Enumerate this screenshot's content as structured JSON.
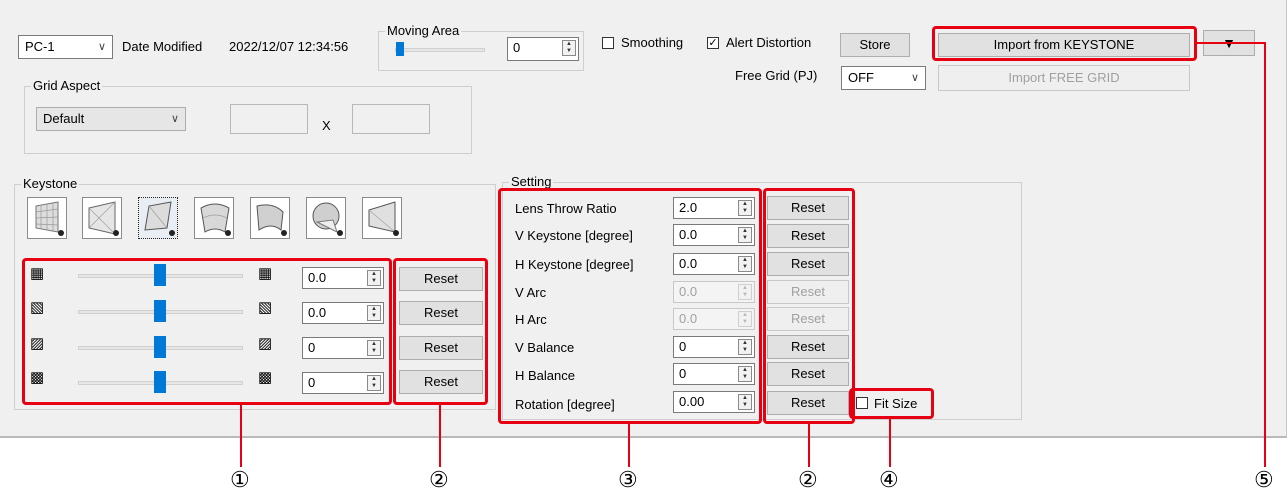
{
  "header": {
    "pc_select": "PC-1",
    "date_label": "Date Modified",
    "date_value": "2022/12/07 12:34:56",
    "moving_area_label": "Moving Area",
    "moving_area_value": "0",
    "smoothing_label": "Smoothing",
    "smoothing_checked": false,
    "alert_label": "Alert Distortion",
    "alert_checked": true,
    "store_label": "Store",
    "import_keystone_label": "Import from KEYSTONE",
    "free_grid_label": "Free Grid (PJ)",
    "free_grid_value": "OFF",
    "import_free_grid_label": "Import FREE GRID"
  },
  "grid_aspect": {
    "label": "Grid Aspect",
    "value": "Default",
    "separator": "X"
  },
  "keystone": {
    "label": "Keystone",
    "tools": [
      "keystone-grid-icon",
      "keystone-flat-icon",
      "keystone-corner-icon",
      "keystone-cylinder-icon",
      "keystone-cylinder-side-icon",
      "keystone-sphere-icon",
      "keystone-perspective-icon"
    ],
    "rows": [
      {
        "value": "0.0",
        "reset": "Reset"
      },
      {
        "value": "0.0",
        "reset": "Reset"
      },
      {
        "value": "0",
        "reset": "Reset"
      },
      {
        "value": "0",
        "reset": "Reset"
      }
    ]
  },
  "setting": {
    "label": "Setting",
    "rows": [
      {
        "label": "Lens Throw Ratio",
        "value": "2.0",
        "reset": "Reset",
        "enabled": true
      },
      {
        "label": "V Keystone [degree]",
        "value": "0.0",
        "reset": "Reset",
        "enabled": true
      },
      {
        "label": "H Keystone [degree]",
        "value": "0.0",
        "reset": "Reset",
        "enabled": true
      },
      {
        "label": "V Arc",
        "value": "0.0",
        "reset": "Reset",
        "enabled": false
      },
      {
        "label": "H Arc",
        "value": "0.0",
        "reset": "Reset",
        "enabled": false
      },
      {
        "label": "V Balance",
        "value": "0",
        "reset": "Reset",
        "enabled": true
      },
      {
        "label": "H Balance",
        "value": "0",
        "reset": "Reset",
        "enabled": true
      },
      {
        "label": "Rotation [degree]",
        "value": "0.00",
        "reset": "Reset",
        "enabled": true
      }
    ],
    "fit_size_label": "Fit Size",
    "fit_size_checked": false
  },
  "callouts": [
    "①",
    "②",
    "③",
    "②",
    "④",
    "⑤"
  ],
  "colors": {
    "highlight": "#e60012",
    "slider": "#0078d7",
    "panel": "#f0f0f0"
  }
}
